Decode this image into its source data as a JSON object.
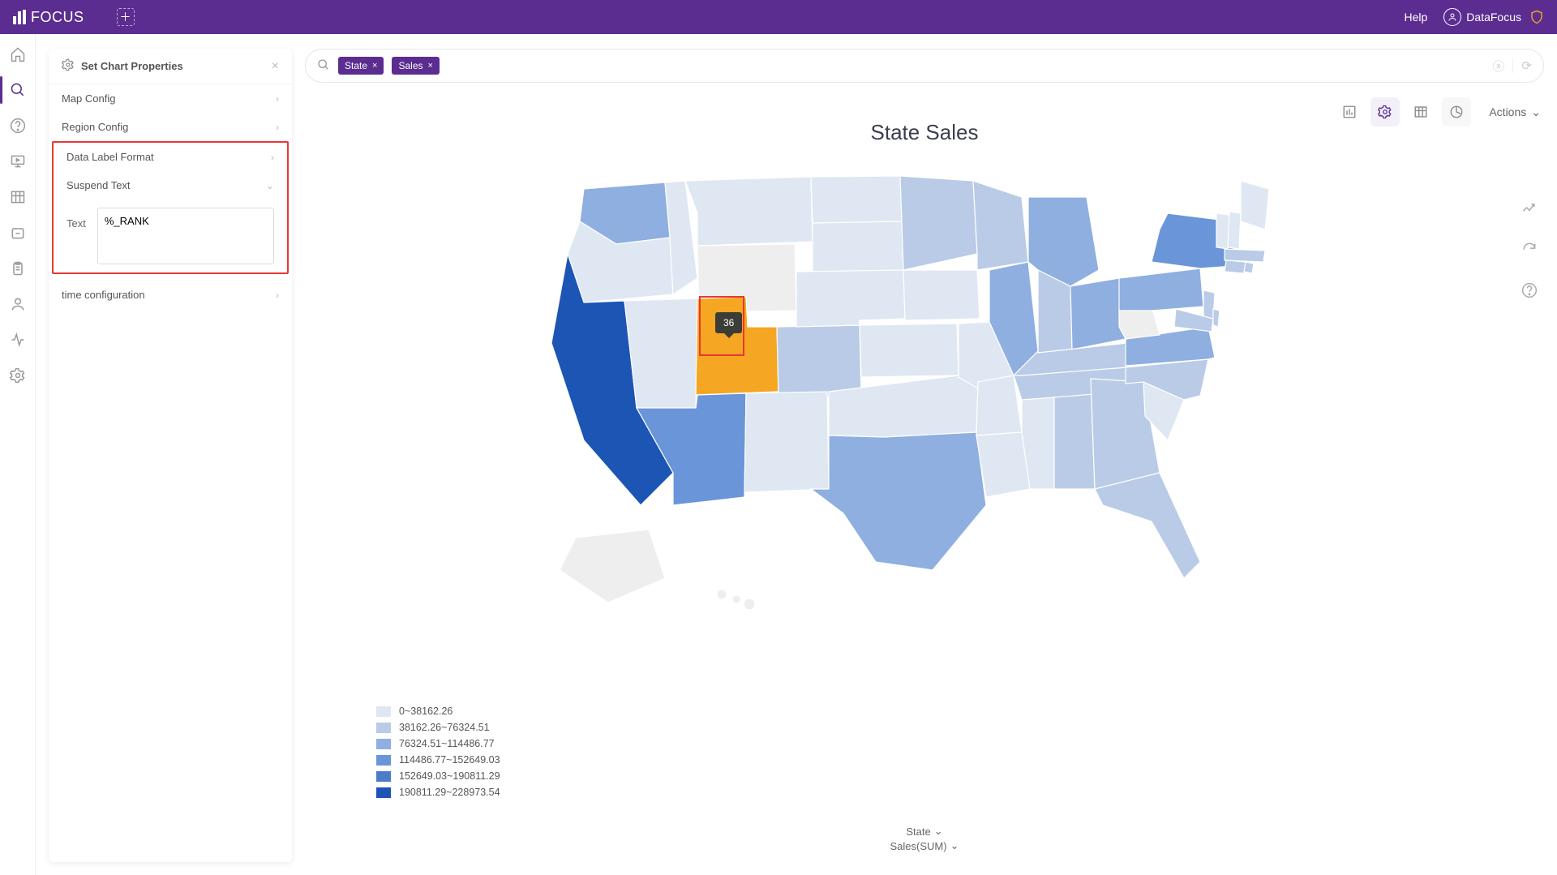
{
  "app": {
    "name": "FOCUS"
  },
  "header": {
    "help": "Help",
    "user": "DataFocus"
  },
  "panel": {
    "title": "Set Chart Properties",
    "rows": {
      "map_config": "Map Config",
      "region_config": "Region Config",
      "data_label_format": "Data Label Format",
      "suspend_text": "Suspend Text",
      "text_label": "Text",
      "text_value": "%_RANK",
      "time_config": "time configuration"
    }
  },
  "query": {
    "pills": [
      "State",
      "Sales"
    ]
  },
  "toolbar": {
    "actions": "Actions"
  },
  "chart": {
    "title": "State Sales",
    "tooltip_value": "36",
    "axis1": "State",
    "axis2": "Sales(SUM)",
    "legend": [
      {
        "color": "#dfe7f2",
        "label": "0~38162.26"
      },
      {
        "color": "#b9cbe6",
        "label": "38162.26~76324.51"
      },
      {
        "color": "#8eafe0",
        "label": "76324.51~114486.77"
      },
      {
        "color": "#6a95d8",
        "label": "114486.77~152649.03"
      },
      {
        "color": "#4e7cc9",
        "label": "152649.03~190811.29"
      },
      {
        "color": "#1c55b4",
        "label": "190811.29~228973.54"
      }
    ]
  },
  "chart_data": {
    "type": "map",
    "region": "USA-states",
    "title": "State Sales",
    "value_label": "Sales(SUM)",
    "category_label": "State",
    "bins": [
      0,
      38162.26,
      76324.51,
      114486.77,
      152649.03,
      190811.29,
      228973.54
    ],
    "highlighted_state": "Utah",
    "highlighted_rank": 36,
    "state_bins": {
      "California": 6,
      "New York": 4,
      "Arizona": 4,
      "Washington": 3,
      "Texas": 3,
      "Pennsylvania": 3,
      "Illinois": 3,
      "Ohio": 3,
      "Michigan": 3,
      "Florida": 2,
      "Virginia": 3,
      "Georgia": 2,
      "Indiana": 2,
      "Colorado": 2,
      "Wisconsin": 2,
      "Tennessee": 2,
      "North Carolina": 2,
      "Minnesota": 2,
      "Massachusetts": 2,
      "New Jersey": 2,
      "Maryland": 2,
      "Delaware": 2,
      "Kentucky": 2,
      "Oregon": 1,
      "Nevada": 1,
      "Utah": 1,
      "Idaho": 1,
      "Montana": 1,
      "New Mexico": 1,
      "Oklahoma": 1,
      "Kansas": 1,
      "Nebraska": 1,
      "Iowa": 1,
      "Missouri": 1,
      "Arkansas": 1,
      "Louisiana": 1,
      "Mississippi": 1,
      "Alabama": 2,
      "South Carolina": 1,
      "Connecticut": 2,
      "Rhode Island": 2,
      "New Hampshire": 1,
      "Vermont": 1,
      "Maine": 1,
      "North Dakota": 1,
      "South Dakota": 1,
      "Wyoming": 0,
      "West Virginia": 0,
      "Alaska": 0,
      "Hawaii": 0
    }
  }
}
